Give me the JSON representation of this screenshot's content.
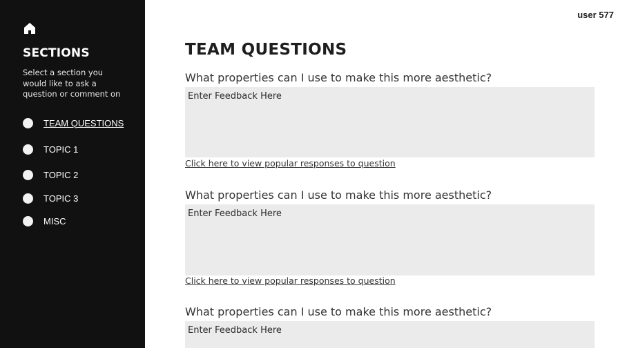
{
  "sidebar": {
    "home_icon": "home-icon",
    "title": "SECTIONS",
    "description": "Select a section you would like to ask a question or comment on",
    "items": [
      {
        "label": "TEAM QUESTIONS",
        "active": true
      },
      {
        "label": "TOPIC 1",
        "active": false
      },
      {
        "label": "TOPIC 2",
        "active": false
      },
      {
        "label": "TOPIC 3",
        "active": false
      },
      {
        "label": "MISC",
        "active": false
      }
    ]
  },
  "header": {
    "user": "user 577"
  },
  "main": {
    "title": "TEAM QUESTIONS",
    "questions": [
      {
        "text": "What properties can I use to make this more aesthetic?",
        "placeholder": "Enter Feedback Here",
        "link": "Click here to view popular responses to question"
      },
      {
        "text": "What properties can I use to make this more aesthetic?",
        "placeholder": "Enter Feedback Here",
        "link": "Click here to view popular responses to question"
      },
      {
        "text": "What properties can I use to make this more aesthetic?",
        "placeholder": "Enter Feedback Here"
      }
    ]
  },
  "colors": {
    "sidebar_bg": "#111111",
    "input_bg": "#ebebeb"
  }
}
